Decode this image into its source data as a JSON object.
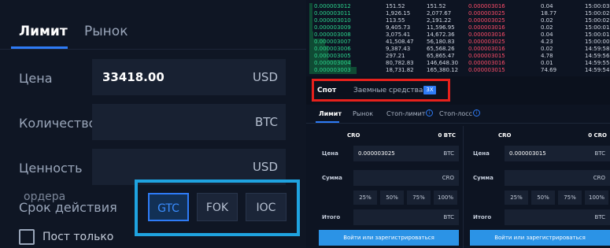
{
  "left_panel": {
    "tabs": [
      "Лимит",
      "Рынок"
    ],
    "fields": [
      {
        "label": "Цена",
        "value": "33418.00",
        "unit": "USD"
      },
      {
        "label": "Количество",
        "value": "",
        "unit": "BTC"
      },
      {
        "label": "Ценность",
        "value": "",
        "unit": "USD"
      }
    ],
    "order_label_overlap": "ордера",
    "time_in_force_label": "Срок действия",
    "time_in_force_options": [
      "GTC",
      "FOK",
      "IOC"
    ],
    "time_in_force_selected": "GTC",
    "post_only_label": "Пост только"
  },
  "orderbook": {
    "bids": [
      {
        "price": "0.000003012",
        "amount": "151.52",
        "total": "151.52"
      },
      {
        "price": "0.000003011",
        "amount": "1,926.15",
        "total": "2,077.67"
      },
      {
        "price": "0.000003010",
        "amount": "113.55",
        "total": "2,191.22"
      },
      {
        "price": "0.000003009",
        "amount": "9,405.73",
        "total": "11,596.95"
      },
      {
        "price": "0.000003008",
        "amount": "3,075.41",
        "total": "14,672.36"
      },
      {
        "price": "0.000003007",
        "amount": "41,508.47",
        "total": "56,180.83"
      },
      {
        "price": "0.000003006",
        "amount": "9,387.43",
        "total": "65,568.26"
      },
      {
        "price": "0.000003005",
        "amount": "297.21",
        "total": "65,865.47"
      },
      {
        "price": "0.000003004",
        "amount": "80,782.83",
        "total": "146,648.30"
      },
      {
        "price": "0.000003003",
        "amount": "18,731.82",
        "total": "165,380.12"
      }
    ],
    "trades": [
      {
        "price": "0.000003016",
        "amount": "0.04",
        "time": "15:00:03"
      },
      {
        "price": "0.000003025",
        "amount": "18.77",
        "time": "15:00:02"
      },
      {
        "price": "0.000003025",
        "amount": "0.02",
        "time": "15:00:02"
      },
      {
        "price": "0.000003016",
        "amount": "0.02",
        "time": "15:00:01"
      },
      {
        "price": "0.000003016",
        "amount": "0.04",
        "time": "15:00:01"
      },
      {
        "price": "0.000003025",
        "amount": "4.23",
        "time": "15:00:00"
      },
      {
        "price": "0.000003016",
        "amount": "0.02",
        "time": "14:59:58"
      },
      {
        "price": "0.000003015",
        "amount": "4.78",
        "time": "14:59:56"
      },
      {
        "price": "0.000003016",
        "amount": "0.01",
        "time": "14:59:55"
      },
      {
        "price": "0.000003015",
        "amount": "74.69",
        "time": "14:59:54"
      }
    ],
    "bid_depth_fractions": [
      0.001,
      0.013,
      0.013,
      0.07,
      0.089,
      0.34,
      0.4,
      0.4,
      0.89,
      1.0
    ]
  },
  "spot_tabs": {
    "spot": "Спот",
    "margin": "Заемные средства",
    "margin_badge": "3X"
  },
  "order_tabs": {
    "items": [
      "Лимит",
      "Рынок",
      "Стоп-лимит",
      "Стоп-лосс"
    ],
    "info_icon": "i"
  },
  "buy_form": {
    "currency": "CRO",
    "balance": "0 BTC",
    "price_label": "Цена",
    "price_value": "0.000003025",
    "price_unit": "BTC",
    "amount_label": "Сумма",
    "amount_unit": "CRO",
    "percents": [
      "25%",
      "50%",
      "75%",
      "100%"
    ],
    "total_label": "Итого",
    "total_unit": "BTC",
    "cta": "Войти или зарегистрироваться"
  },
  "sell_form": {
    "currency": "CRO",
    "balance": "0 CRO",
    "price_label": "Цена",
    "price_value": "0.000003015",
    "price_unit": "BTC",
    "amount_label": "Сумма",
    "amount_unit": "CRO",
    "percents": [
      "25%",
      "50%",
      "75%",
      "100%"
    ],
    "total_label": "Итого",
    "total_unit": "BTC",
    "cta": "Войти или зарегистрироваться"
  },
  "colors": {
    "accent": "#2e7bf6",
    "highlight_box": "#1fa3e0",
    "red_box": "#e6211c",
    "bid": "#2bd48d",
    "ask": "#ff4d6a"
  }
}
